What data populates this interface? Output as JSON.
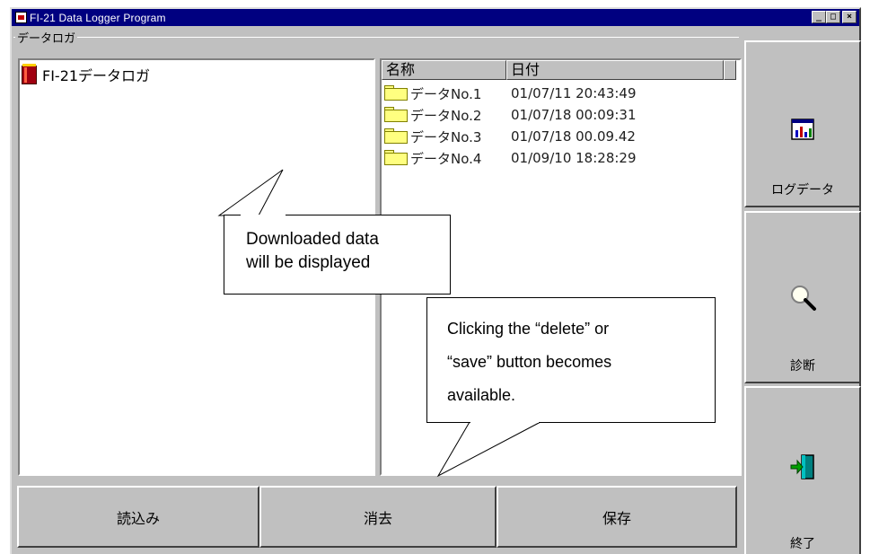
{
  "window": {
    "title": "FI-21 Data Logger Program",
    "minimize": "_",
    "maximize": "□",
    "close": "×"
  },
  "group": {
    "label": "データロガ"
  },
  "tree": {
    "root_label": "FI-21データロガ"
  },
  "list": {
    "columns": [
      "名称",
      "日付"
    ],
    "rows": [
      {
        "name": "データNo.1",
        "date": "01/07/11 20:43:49"
      },
      {
        "name": "データNo.2",
        "date": "01/07/18 00:09:31"
      },
      {
        "name": "データNo.3",
        "date": "01/07/18 00.09.42"
      },
      {
        "name": "データNo.4",
        "date": "01/09/10 18:28:29"
      }
    ]
  },
  "buttons": {
    "read": "読込み",
    "delete": "消去",
    "save": "保存"
  },
  "side": {
    "log_data": "ログデータ",
    "diagnosis": "診断",
    "exit": "終了"
  },
  "callouts": {
    "downloaded": [
      "Downloaded  data",
      "will be displayed"
    ],
    "clicking": [
      "Clicking  the  “delete”  or",
      "“save”  button  becomes",
      "available."
    ]
  },
  "icons": {
    "title": "app-icon",
    "tree_root": "book-icon",
    "row": "folder-icon",
    "log_data": "chart-icon",
    "diagnosis": "magnifier-icon",
    "exit": "exit-door-icon"
  }
}
